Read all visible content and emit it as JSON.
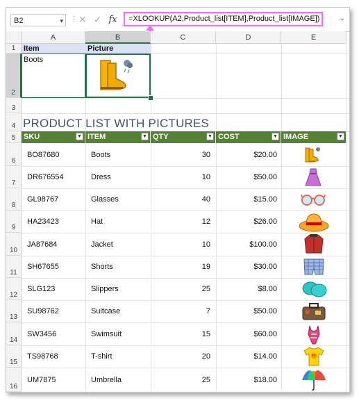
{
  "formula_bar": {
    "name_box": "B2",
    "formula": "=XLOOKUP(A2,Product_list[ITEM],Product_list[IMAGE])",
    "cancel_icon": "x-icon",
    "enter_icon": "check-icon",
    "fx_label": "fx"
  },
  "columns": [
    "A",
    "B",
    "C",
    "D",
    "E"
  ],
  "rows": [
    "1",
    "2",
    "3",
    "4",
    "5",
    "6",
    "7",
    "8",
    "9",
    "10",
    "11",
    "12",
    "13",
    "14",
    "15",
    "16"
  ],
  "lookup": {
    "item_header": "Item",
    "picture_header": "Picture",
    "item_value": "Boots",
    "picture_icon": "boots-icon"
  },
  "product_title": "PRODUCT LIST WITH PICTURES",
  "table": {
    "headers": [
      "SKU",
      "ITEM",
      "QTY",
      "COST",
      "IMAGE"
    ],
    "rows": [
      {
        "sku": "BO87680",
        "item": "Boots",
        "qty": "30",
        "cost": "$20.00",
        "icon": "boots-icon"
      },
      {
        "sku": "DR676554",
        "item": "Dress",
        "qty": "10",
        "cost": "$50.00",
        "icon": "dress-icon"
      },
      {
        "sku": "GL98767",
        "item": "Glasses",
        "qty": "40",
        "cost": "$15.00",
        "icon": "glasses-icon"
      },
      {
        "sku": "HA23423",
        "item": "Hat",
        "qty": "12",
        "cost": "$26.00",
        "icon": "hat-icon"
      },
      {
        "sku": "JA87684",
        "item": "Jacket",
        "qty": "10",
        "cost": "$100.00",
        "icon": "jacket-icon"
      },
      {
        "sku": "SH67655",
        "item": "Shorts",
        "qty": "19",
        "cost": "$30.00",
        "icon": "shorts-icon"
      },
      {
        "sku": "SLG123",
        "item": "Slippers",
        "qty": "25",
        "cost": "$8.00",
        "icon": "slippers-icon"
      },
      {
        "sku": "SU98762",
        "item": "Suitcase",
        "qty": "7",
        "cost": "$50.00",
        "icon": "suitcase-icon"
      },
      {
        "sku": "SW3456",
        "item": "Swimsuit",
        "qty": "15",
        "cost": "$60.00",
        "icon": "swimsuit-icon"
      },
      {
        "sku": "TS98768",
        "item": "T-shirt",
        "qty": "20",
        "cost": "$14.00",
        "icon": "tshirt-icon"
      },
      {
        "sku": "UM7875",
        "item": "Umbrella",
        "qty": "25",
        "cost": "$18.00",
        "icon": "umbrella-icon"
      }
    ]
  },
  "colors": {
    "table_header": "#548235",
    "lookup_header": "#d9e1f2",
    "title": "#44546a",
    "selection": "#217346",
    "formula_highlight": "#ff66ff"
  }
}
